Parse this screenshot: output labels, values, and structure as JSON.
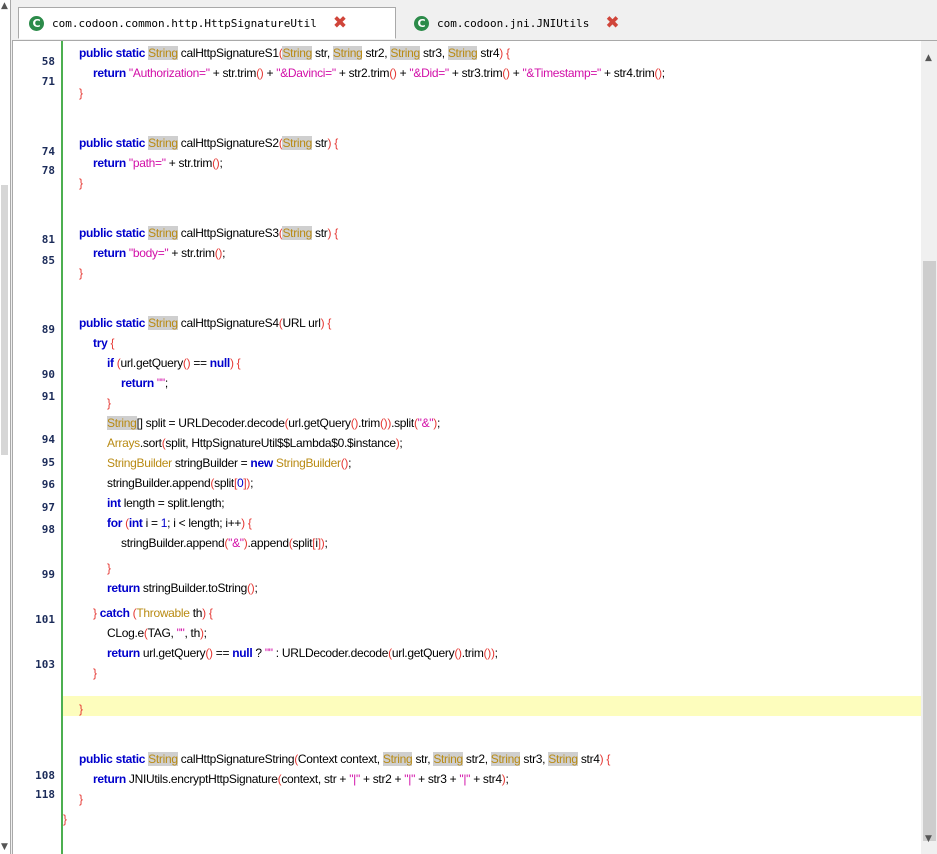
{
  "tabs": [
    {
      "label": "com.codoon.common.http.HttpSignatureUtil",
      "icon": "class-icon",
      "active": true
    },
    {
      "label": "com.codoon.jni.JNIUtils",
      "icon": "class-icon",
      "active": false
    }
  ],
  "colors": {
    "keyword": "#0000cc",
    "type": "#b98b14",
    "string": "#d20fa8",
    "punct": "#e53935",
    "line_number": "#1c2c5a",
    "gutter_line": "#4caf50",
    "highlight": "#fdfdbd"
  },
  "line_numbers": [
    "58",
    "71",
    "74",
    "78",
    "81",
    "85",
    "89",
    "90",
    "91",
    "94",
    "95",
    "96",
    "97",
    "98",
    "99",
    "101",
    "103",
    "108",
    "118"
  ],
  "code_lines": [
    [
      [
        "k",
        "public static "
      ],
      [
        "tb",
        "String"
      ],
      [
        "n",
        " calHttpSignatureS1"
      ],
      [
        "p",
        "("
      ],
      [
        "tb",
        "String"
      ],
      [
        "n",
        " str, "
      ],
      [
        "tb",
        "String"
      ],
      [
        "n",
        " str2, "
      ],
      [
        "tb",
        "String"
      ],
      [
        "n",
        " str3, "
      ],
      [
        "tb",
        "String"
      ],
      [
        "n",
        " str4"
      ],
      [
        "p",
        ") {"
      ]
    ],
    [
      [
        "k",
        "return "
      ],
      [
        "s",
        "\"Authorization=\""
      ],
      [
        "n",
        " + str.trim"
      ],
      [
        "p",
        "()"
      ],
      [
        "n",
        " + "
      ],
      [
        "s",
        "\"&Davinci=\""
      ],
      [
        "n",
        " + str2.trim"
      ],
      [
        "p",
        "()"
      ],
      [
        "n",
        " + "
      ],
      [
        "s",
        "\"&Did=\""
      ],
      [
        "n",
        " + str3.trim"
      ],
      [
        "p",
        "()"
      ],
      [
        "n",
        " + "
      ],
      [
        "s",
        "\"&Timestamp=\""
      ],
      [
        "n",
        " + str4.trim"
      ],
      [
        "p",
        "()"
      ],
      [
        "n",
        ";"
      ]
    ],
    [
      [
        "p",
        "}"
      ]
    ],
    [],
    [
      [
        "k",
        "public static "
      ],
      [
        "tb",
        "String"
      ],
      [
        "n",
        " calHttpSignatureS2"
      ],
      [
        "p",
        "("
      ],
      [
        "tb",
        "String"
      ],
      [
        "n",
        " str"
      ],
      [
        "p",
        ") {"
      ]
    ],
    [
      [
        "k",
        "return "
      ],
      [
        "s",
        "\"path=\""
      ],
      [
        "n",
        " + str.trim"
      ],
      [
        "p",
        "()"
      ],
      [
        "n",
        ";"
      ]
    ],
    [
      [
        "p",
        "}"
      ]
    ],
    [],
    [
      [
        "k",
        "public static "
      ],
      [
        "tb",
        "String"
      ],
      [
        "n",
        " calHttpSignatureS3"
      ],
      [
        "p",
        "("
      ],
      [
        "tb",
        "String"
      ],
      [
        "n",
        " str"
      ],
      [
        "p",
        ") {"
      ]
    ],
    [
      [
        "k",
        "return "
      ],
      [
        "s",
        "\"body=\""
      ],
      [
        "n",
        " + str.trim"
      ],
      [
        "p",
        "()"
      ],
      [
        "n",
        ";"
      ]
    ],
    [
      [
        "p",
        "}"
      ]
    ],
    [],
    [
      [
        "k",
        "public static "
      ],
      [
        "tb",
        "String"
      ],
      [
        "n",
        " calHttpSignatureS4"
      ],
      [
        "p",
        "("
      ],
      [
        "n",
        "URL url"
      ],
      [
        "p",
        ") {"
      ]
    ],
    [
      [
        "k",
        "try "
      ],
      [
        "p",
        "{"
      ]
    ],
    [
      [
        "k",
        "if "
      ],
      [
        "p",
        "("
      ],
      [
        "n",
        "url.getQuery"
      ],
      [
        "p",
        "()"
      ],
      [
        "n",
        " == "
      ],
      [
        "k",
        "null"
      ],
      [
        "p",
        ") {"
      ]
    ],
    [
      [
        "k",
        "return "
      ],
      [
        "s",
        "\"\""
      ],
      [
        "n",
        ";"
      ]
    ],
    [
      [
        "p",
        "}"
      ]
    ],
    [
      [
        "tb",
        "String"
      ],
      [
        "n",
        "[] split = URLDecoder.decode"
      ],
      [
        "p",
        "("
      ],
      [
        "n",
        "url.getQuery"
      ],
      [
        "p",
        "()"
      ],
      [
        "n",
        ".trim"
      ],
      [
        "p",
        "())"
      ],
      [
        "n",
        ".split"
      ],
      [
        "p",
        "("
      ],
      [
        "s",
        "\"&\""
      ],
      [
        "p",
        ")"
      ],
      [
        "n",
        ";"
      ]
    ],
    [
      [
        "t",
        "Arrays"
      ],
      [
        "n",
        ".sort"
      ],
      [
        "p",
        "("
      ],
      [
        "n",
        "split, HttpSignatureUtil$$Lambda$0.$instance"
      ],
      [
        "p",
        ")"
      ],
      [
        "n",
        ";"
      ]
    ],
    [
      [
        "t",
        "StringBuilder"
      ],
      [
        "n",
        " stringBuilder = "
      ],
      [
        "k",
        "new "
      ],
      [
        "t",
        "StringBuilder"
      ],
      [
        "p",
        "()"
      ],
      [
        "n",
        ";"
      ]
    ],
    [
      [
        "n",
        "stringBuilder.append"
      ],
      [
        "p",
        "("
      ],
      [
        "n",
        "split"
      ],
      [
        "p",
        "["
      ],
      [
        "u",
        "0"
      ],
      [
        "p",
        "])"
      ],
      [
        "n",
        ";"
      ]
    ],
    [
      [
        "k",
        "int"
      ],
      [
        "n",
        " length = split.length;"
      ]
    ],
    [
      [
        "k",
        "for "
      ],
      [
        "p",
        "("
      ],
      [
        "k",
        "int"
      ],
      [
        "n",
        " i = "
      ],
      [
        "u",
        "1"
      ],
      [
        "n",
        "; i < length; i++"
      ],
      [
        "p",
        ") {"
      ]
    ],
    [
      [
        "n",
        "stringBuilder.append"
      ],
      [
        "p",
        "("
      ],
      [
        "s",
        "\"&\""
      ],
      [
        "p",
        ")"
      ],
      [
        "n",
        ".append"
      ],
      [
        "p",
        "("
      ],
      [
        "n",
        "split"
      ],
      [
        "p",
        "["
      ],
      [
        "n",
        "i"
      ],
      [
        "p",
        "])"
      ],
      [
        "n",
        ";"
      ]
    ],
    [
      [
        "p",
        "}"
      ]
    ],
    [
      [
        "k",
        "return "
      ],
      [
        "n",
        "stringBuilder.toString"
      ],
      [
        "p",
        "()"
      ],
      [
        "n",
        ";"
      ]
    ],
    [
      [
        "p",
        "} "
      ],
      [
        "k",
        "catch "
      ],
      [
        "p",
        "("
      ],
      [
        "t",
        "Throwable"
      ],
      [
        "n",
        " th"
      ],
      [
        "p",
        ") {"
      ]
    ],
    [
      [
        "n",
        "CLog.e"
      ],
      [
        "p",
        "("
      ],
      [
        "n",
        "TAG, "
      ],
      [
        "s",
        "\"\""
      ],
      [
        "n",
        ", th"
      ],
      [
        "p",
        ")"
      ],
      [
        "n",
        ";"
      ]
    ],
    [
      [
        "k",
        "return "
      ],
      [
        "n",
        "url.getQuery"
      ],
      [
        "p",
        "()"
      ],
      [
        "n",
        " == "
      ],
      [
        "k",
        "null"
      ],
      [
        "n",
        " ? "
      ],
      [
        "s",
        "\"\""
      ],
      [
        "n",
        " : URLDecoder.decode"
      ],
      [
        "p",
        "("
      ],
      [
        "n",
        "url.getQuery"
      ],
      [
        "p",
        "()"
      ],
      [
        "n",
        ".trim"
      ],
      [
        "p",
        "())"
      ],
      [
        "n",
        ";"
      ]
    ],
    [
      [
        "p",
        "}"
      ]
    ],
    [
      [
        "p",
        "}"
      ]
    ],
    [],
    [
      [
        "k",
        "public static "
      ],
      [
        "tb",
        "String"
      ],
      [
        "n",
        " calHttpSignatureString"
      ],
      [
        "p",
        "("
      ],
      [
        "n",
        "Context context, "
      ],
      [
        "tb",
        "String"
      ],
      [
        "n",
        " str, "
      ],
      [
        "tb",
        "String"
      ],
      [
        "n",
        " str2, "
      ],
      [
        "tb",
        "String"
      ],
      [
        "n",
        " str3, "
      ],
      [
        "tb",
        "String"
      ],
      [
        "n",
        " str4"
      ],
      [
        "p",
        ") {"
      ]
    ],
    [
      [
        "k",
        "return "
      ],
      [
        "n",
        "JNIUtils.encryptHttpSignature"
      ],
      [
        "p",
        "("
      ],
      [
        "n",
        "context, str + "
      ],
      [
        "s",
        "\"|\""
      ],
      [
        "n",
        " + str2 + "
      ],
      [
        "s",
        "\"|\""
      ],
      [
        "n",
        " + str3 + "
      ],
      [
        "s",
        "\"|\""
      ],
      [
        "n",
        " + str4"
      ],
      [
        "p",
        ")"
      ],
      [
        "n",
        ";"
      ]
    ],
    [
      [
        "p",
        "}"
      ]
    ],
    [
      [
        "p",
        "}"
      ]
    ]
  ]
}
